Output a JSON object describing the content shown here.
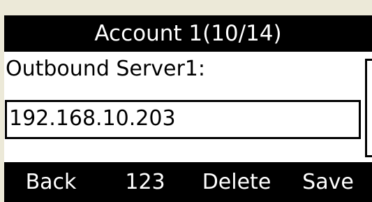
{
  "title": "Account 1(10/14)",
  "field": {
    "label": "Outbound Server1:",
    "value": "192.168.10.203"
  },
  "softkeys": [
    {
      "label": "Back"
    },
    {
      "label": "123"
    },
    {
      "label": "Delete"
    },
    {
      "label": "Save"
    }
  ],
  "colors": {
    "background": "#ece9d8",
    "screen": "#ffffff",
    "bar": "#000000",
    "bar_text": "#ffffff"
  }
}
